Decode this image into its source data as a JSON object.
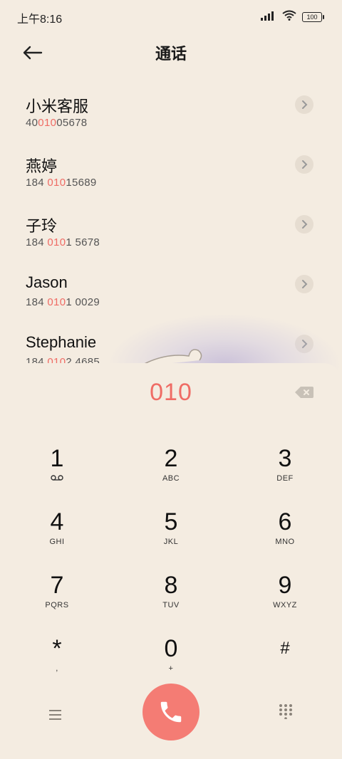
{
  "status_bar": {
    "time": "上午8:16",
    "battery": "100"
  },
  "header": {
    "title": "通话"
  },
  "contacts": [
    {
      "name": "小米客服",
      "number_pre": "40",
      "number_hl": "010",
      "number_post": "05678"
    },
    {
      "name": "燕婷",
      "number_pre": "184 ",
      "number_hl": "010",
      "number_post": "15689"
    },
    {
      "name": "子玲",
      "number_pre": "184 ",
      "number_hl": "010",
      "number_post": "1 5678"
    },
    {
      "name": "Jason",
      "number_pre": "184 ",
      "number_hl": "010",
      "number_post": "1 0029"
    },
    {
      "name": "Stephanie",
      "number_pre": "184 ",
      "number_hl": "010",
      "number_post": "2 4685"
    }
  ],
  "dialpad": {
    "typed": "010",
    "keys": [
      {
        "digit": "1",
        "letters": ""
      },
      {
        "digit": "2",
        "letters": "ABC"
      },
      {
        "digit": "3",
        "letters": "DEF"
      },
      {
        "digit": "4",
        "letters": "GHI"
      },
      {
        "digit": "5",
        "letters": "JKL"
      },
      {
        "digit": "6",
        "letters": "MNO"
      },
      {
        "digit": "7",
        "letters": "PQRS"
      },
      {
        "digit": "8",
        "letters": "TUV"
      },
      {
        "digit": "9",
        "letters": "WXYZ"
      },
      {
        "digit": "*",
        "letters": ","
      },
      {
        "digit": "0",
        "letters": "+"
      },
      {
        "digit": "#",
        "letters": ""
      }
    ]
  },
  "colors": {
    "accent": "#ef6c65",
    "call": "#f47c74",
    "background": "#f4ece1"
  },
  "icons": [
    "back-arrow-icon",
    "chevron-right-icon",
    "backspace-icon",
    "voicemail-icon",
    "menu-icon",
    "phone-icon",
    "keypad-icon"
  ]
}
